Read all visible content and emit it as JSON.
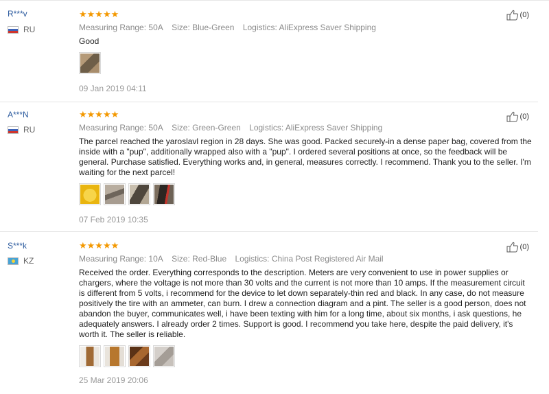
{
  "reviews": [
    {
      "user": "R***v",
      "country": "RU",
      "flag": "ru",
      "stars": "★★★★★",
      "rating": 5,
      "measuring_range": "Measuring Range: 50A",
      "size": "Size: Blue-Green",
      "logistics": "Logistics: AliExpress Saver Shipping",
      "text": "Good",
      "date": "09 Jan 2019 04:11",
      "likes": "(0)",
      "photos": [
        "#7b6a53"
      ]
    },
    {
      "user": "A***N",
      "country": "RU",
      "flag": "ru",
      "stars": "★★★★★",
      "rating": 5,
      "measuring_range": "Measuring Range: 50A",
      "size": "Size: Green-Green",
      "logistics": "Logistics: AliExpress Saver Shipping",
      "text": "The parcel reached the yaroslavl region in 28 days. She was good. Packed securely-in a dense paper bag, covered from the inside with a \"pup\", additionally wrapped also with a \"pup\". I ordered several positions at once, so the feedback will be general. Purchase satisfied. Everything works and, in general, measures correctly. I recommend. Thank you to the seller. I'm waiting for the next parcel!",
      "date": "07 Feb 2019 10:35",
      "likes": "(0)",
      "photos": [
        "#f2c41b",
        "#8c8279",
        "#5d5448",
        "#3f3833"
      ]
    },
    {
      "user": "S***k",
      "country": "KZ",
      "flag": "kz",
      "stars": "★★★★★",
      "rating": 5,
      "measuring_range": "Measuring Range: 10A",
      "size": "Size: Red-Blue",
      "logistics": "Logistics: China Post Registered Air Mail",
      "text": "Received the order. Everything corresponds to the description. Meters are very convenient to use in power supplies or chargers, where the voltage is not more than 30 volts and the current is not more than 10 amps. If the measurement circuit is different from 5 volts, i recommend for the device to let down separately-thin red and black. In any case, do not measure positively the tire with an ammeter, can burn. I drew a connection diagram and a pint. The seller is a good person, does not abandon the buyer, communicates well, i have been texting with him for a long time, about six months, i ask questions, he adequately answers. I already order 2 times. Support is good. I recommend you take here, despite the paid delivery, it's worth it. The seller is reliable.",
      "date": "25 Mar 2019 20:06",
      "likes": "(0)",
      "photos": [
        "#a06a35",
        "#b7772e",
        "#8a4f25",
        "#b8b1aa"
      ]
    }
  ]
}
